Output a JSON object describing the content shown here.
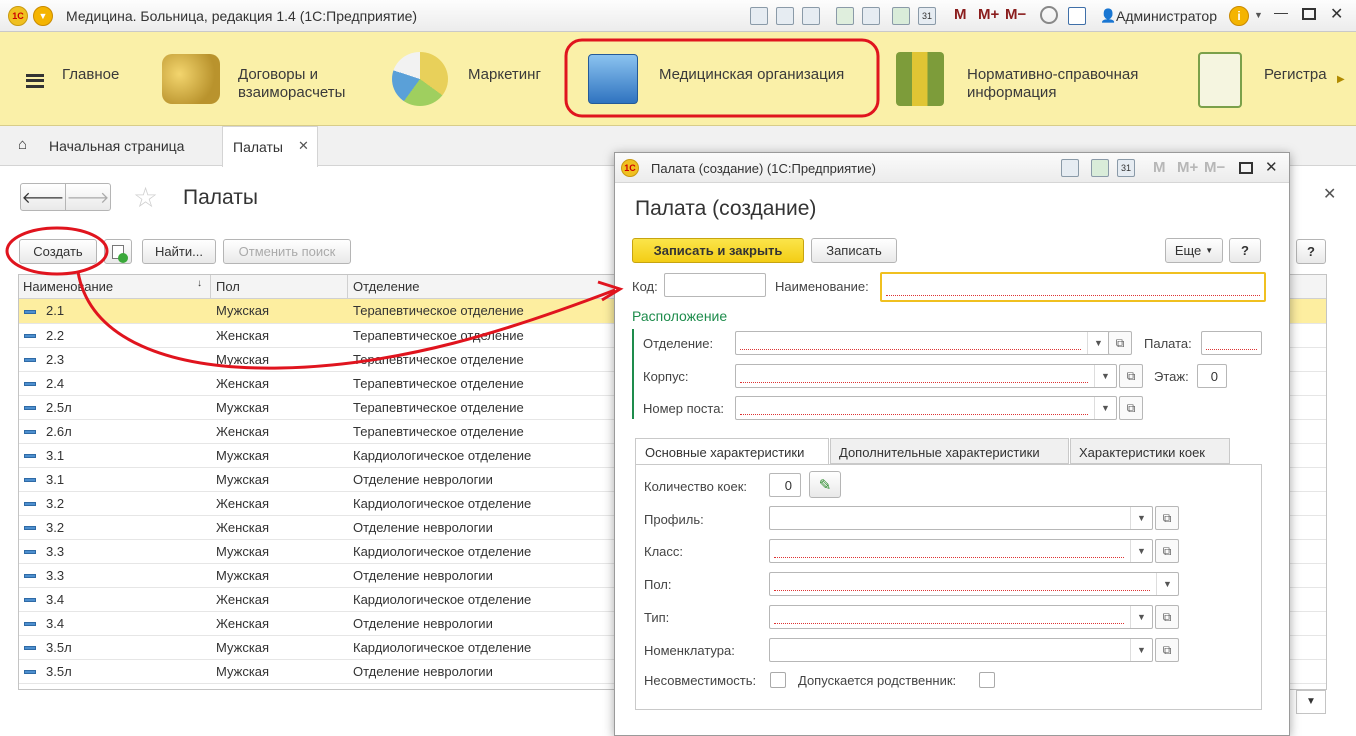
{
  "app": {
    "title": "Медицина. Больница, редакция 1.4 (1С:Предприятие)",
    "logo_text": "1С",
    "m_buttons": [
      "M",
      "M+",
      "M−"
    ],
    "user": "Администратор"
  },
  "sections": [
    {
      "label": "Главное",
      "icon": "menu-icon"
    },
    {
      "label": "Договоры и взаиморасчеты",
      "icon": "coins-icon"
    },
    {
      "label": "Маркетинг",
      "icon": "pie-chart-icon"
    },
    {
      "label": "Медицинская организация",
      "icon": "building-icon"
    },
    {
      "label": "Нормативно-справочная информация",
      "icon": "binders-icon"
    },
    {
      "label": "Регистра",
      "icon": "clipboard-icon"
    }
  ],
  "tabs": {
    "home": "Начальная страница",
    "active": "Палаты"
  },
  "list_form": {
    "title": "Палаты",
    "buttons": {
      "create": "Создать",
      "find": "Найти...",
      "cancel_search": "Отменить поиск",
      "help": "?"
    },
    "columns": [
      "Наименование",
      "Пол",
      "Отделение"
    ],
    "rows": [
      {
        "name": "2.1",
        "sex": "Мужская",
        "dept": "Терапевтическое отделение",
        "selected": true
      },
      {
        "name": "2.2",
        "sex": "Женская",
        "dept": "Терапевтическое отделение"
      },
      {
        "name": "2.3",
        "sex": "Мужская",
        "dept": "Терапевтическое отделение"
      },
      {
        "name": "2.4",
        "sex": "Женская",
        "dept": "Терапевтическое отделение"
      },
      {
        "name": "2.5л",
        "sex": "Мужская",
        "dept": "Терапевтическое отделение"
      },
      {
        "name": "2.6л",
        "sex": "Женская",
        "dept": "Терапевтическое отделение"
      },
      {
        "name": "3.1",
        "sex": "Мужская",
        "dept": "Кардиологическое отделение"
      },
      {
        "name": "3.1",
        "sex": "Мужская",
        "dept": "Отделение неврологии"
      },
      {
        "name": "3.2",
        "sex": "Женская",
        "dept": "Кардиологическое отделение"
      },
      {
        "name": "3.2",
        "sex": "Женская",
        "dept": "Отделение неврологии"
      },
      {
        "name": "3.3",
        "sex": "Мужская",
        "dept": "Кардиологическое отделение"
      },
      {
        "name": "3.3",
        "sex": "Мужская",
        "dept": "Отделение неврологии"
      },
      {
        "name": "3.4",
        "sex": "Женская",
        "dept": "Кардиологическое отделение"
      },
      {
        "name": "3.4",
        "sex": "Женская",
        "dept": "Отделение неврологии"
      },
      {
        "name": "3.5л",
        "sex": "Мужская",
        "dept": "Кардиологическое отделение"
      },
      {
        "name": "3.5л",
        "sex": "Мужская",
        "dept": "Отделение неврологии"
      }
    ]
  },
  "modal": {
    "window_title": "Палата (создание) (1С:Предприятие)",
    "heading": "Палата (создание)",
    "buttons": {
      "save_close": "Записать и закрыть",
      "save": "Записать",
      "more": "Еще",
      "help": "?"
    },
    "labels": {
      "code": "Код:",
      "name": "Наименование:",
      "location": "Расположение",
      "department": "Отделение:",
      "ward": "Палата:",
      "building": "Корпус:",
      "floor": "Этаж:",
      "post": "Номер поста:"
    },
    "values": {
      "floor": "0",
      "beds": "0"
    },
    "inner_tabs": [
      "Основные характеристики",
      "Дополнительные характеристики",
      "Характеристики коек"
    ],
    "chars": {
      "beds": "Количество коек:",
      "profile": "Профиль:",
      "class": "Класс:",
      "sex": "Пол:",
      "type": "Тип:",
      "nomenclature": "Номенклатура:",
      "incompat": "Несовместимость:",
      "relative": "Допускается родственник:"
    }
  },
  "colors": {
    "section_bg": "#faf0a8",
    "accent_yellow": "#f3cd15",
    "annotation_red": "#e0141e",
    "group_green": "#1e8c4c"
  }
}
